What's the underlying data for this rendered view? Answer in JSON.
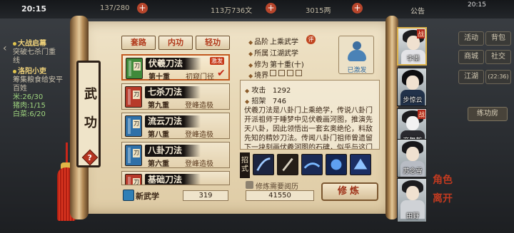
{
  "status": {
    "time": "20:15",
    "time_right": "20:15",
    "network": "4G"
  },
  "resources": {
    "left": "137/280",
    "middle": "113万736文",
    "right": "3015两",
    "notice": "公告"
  },
  "quests": {
    "q1_title": "大战启幕",
    "q1_line1": "突破七杀门重",
    "q1_line2": "线",
    "q2_title": "洛阳小吏",
    "q2_line1": "筹集粮食给安平",
    "q2_line2": "百姓",
    "q2_c1": "米:26/30",
    "q2_c2": "猪肉:1/15",
    "q2_c3": "白菜:6/20"
  },
  "right_menu": {
    "b1": "活动",
    "b2": "背包",
    "b3": "商城",
    "b4": "社交",
    "b5": "江湖",
    "b6": "(22:36)",
    "b7": "练功房"
  },
  "panel": {
    "title_1": "武",
    "title_2": "功",
    "help": "?"
  },
  "tabs": [
    {
      "label": "套路"
    },
    {
      "label": "内功"
    },
    {
      "label": "轻功"
    }
  ],
  "skills": [
    {
      "name": "伏羲刀法",
      "level": "第十重",
      "stage": "初窥门径",
      "badge": "激发",
      "book": "#3f8a3a",
      "mark": "刀"
    },
    {
      "name": "七杀刀法",
      "level": "第九重",
      "stage": "登峰造极",
      "book": "#b73a2a",
      "mark": "刀"
    },
    {
      "name": "流云刀法",
      "level": "第八重",
      "stage": "登峰造极",
      "book": "#2f70a8",
      "mark": "刀"
    },
    {
      "name": "八卦刀法",
      "level": "第六重",
      "stage": "登峰造极",
      "book": "#2f70a8",
      "mark": "刀"
    },
    {
      "name": "基础刀法",
      "level": "",
      "stage": "",
      "book": "#b73a2a",
      "mark": "刀"
    }
  ],
  "new_skill": {
    "label": "新武学",
    "count": "319"
  },
  "detail": {
    "grade_label": "品阶",
    "grade_value": "上乘武学",
    "grade_tag": "评",
    "sect_label": "所属",
    "sect_value": "江湖武学",
    "cult_label": "修为",
    "cult_value": "第十重(十)",
    "realm_label": "境界",
    "portrait_caption": "已激发",
    "attack_label": "攻击",
    "attack_value": "1292",
    "parry_label": "招架",
    "parry_value": "746",
    "description": "伏羲刀法是八卦门上乘绝学，传说八卦门开派祖师于睡梦中见伏羲画河图，推演先天八卦，因此领悟出一套玄奥绝伦，料敌先知的精妙刀法。传闻八卦门祖师曾遗留下一块刻画伏羲河图的石碑，似乎与这门刀法有着千丝万缕的联系。",
    "moves_label": "招式",
    "tip": "修炼需要阅历",
    "exp_value": "41550",
    "train_button": "修炼"
  },
  "characters": [
    {
      "name": "李墨",
      "fight": "战"
    },
    {
      "name": "步惊云",
      "fight": ""
    },
    {
      "name": "商舞乾",
      "fight": "战"
    },
    {
      "name": "苏念雪",
      "fight": ""
    },
    {
      "name": "田野",
      "fight": ""
    }
  ],
  "brand": {
    "line1": "角色",
    "line2": "离开"
  },
  "colors": {
    "accent": "#c1581f",
    "parchment": "#e6d6b3",
    "title_red": "#b13a1c"
  }
}
